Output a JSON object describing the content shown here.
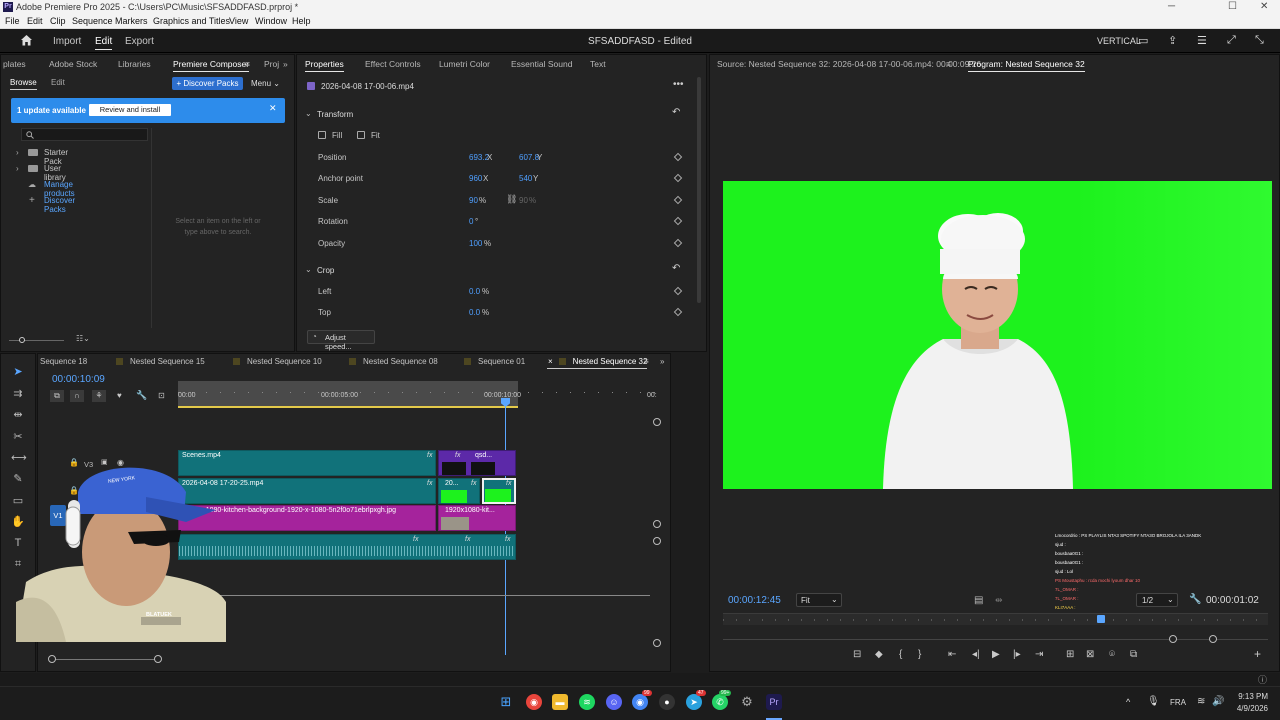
{
  "window": {
    "title": "Adobe Premiere Pro 2025 - C:\\Users\\PC\\Music\\SFSADDFASD.prproj *",
    "app_icon": "Pr"
  },
  "menu": [
    "File",
    "Edit",
    "Clip",
    "Sequence",
    "Markers",
    "Graphics and Titles",
    "View",
    "Window",
    "Help"
  ],
  "header": {
    "tabs": [
      "Import",
      "Edit",
      "Export"
    ],
    "active_tab": "Edit",
    "project_title": "SFSADDFASD - Edited",
    "layout_mode": "VERTICAL"
  },
  "left_panel": {
    "tabs": [
      "plates",
      "Adobe Stock",
      "Libraries",
      "Premiere Composer",
      "Proj"
    ],
    "active_tab": "Premiere Composer",
    "sub_tabs": [
      "Browse",
      "Edit"
    ],
    "discover_button": "+ Discover Packs",
    "menu_label": "Menu",
    "banner_text": "1 update available",
    "banner_button": "Review and install",
    "tree": [
      "Starter Pack",
      "User library",
      "Manage products",
      "Discover Packs"
    ],
    "empty_hint": "Select an item on the left or type above to search."
  },
  "properties": {
    "tabs": [
      "Properties",
      "Effect Controls",
      "Lumetri Color",
      "Essential Sound",
      "Text"
    ],
    "active_tab": "Properties",
    "clip_name": "2026-04-08 17-00-06.mp4",
    "transform": {
      "section_title": "Transform",
      "fill_label": "Fill",
      "fit_label": "Fit",
      "rows": [
        {
          "label": "Position",
          "v1": "693.2",
          "u1": "X",
          "v2": "607.8",
          "u2": "Y"
        },
        {
          "label": "Anchor point",
          "v1": "960",
          "u1": "X",
          "v2": "540",
          "u2": "Y"
        },
        {
          "label": "Scale",
          "v1": "90",
          "u1": "%",
          "v2": "90",
          "u2": "%"
        },
        {
          "label": "Rotation",
          "v1": "0",
          "u1": "°",
          "v2": "",
          "u2": ""
        },
        {
          "label": "Opacity",
          "v1": "100",
          "u1": "%",
          "v2": "",
          "u2": ""
        }
      ]
    },
    "crop": {
      "section_title": "Crop",
      "rows": [
        {
          "label": "Left",
          "v1": "0.0",
          "u1": "%"
        },
        {
          "label": "Top",
          "v1": "0.0",
          "u1": "%"
        }
      ]
    },
    "adjust_speed": "Adjust speed..."
  },
  "monitor": {
    "source_tab": "Source: Nested Sequence 32: 2026-04-08 17-00-06.mp4: 00:00:09:26",
    "program_tab": "Program: Nested Sequence 32",
    "current_time": "00:00:12:45",
    "fit": "Fit",
    "resolution": "1/2",
    "duration": "00:00:01:02",
    "chat_lines": [
      "Lmocordrio : PS PLAYLIS NTA3 SPOTIFY NTA3O BROJOLA ILA 3ANDK",
      "sjud :",
      "bousbaa0G1 :",
      "bousbaa0G1 :",
      "sjud : Lol",
      "PS Moustaphu : rcda mochi lyoum dhar 10",
      "7L_OMAR :",
      "7L_OMAR :",
      "KLI7AAA :"
    ]
  },
  "timeline": {
    "sequence_tabs": [
      "Sequence 18",
      "Nested Sequence 15",
      "Nested Sequence 10",
      "Nested Sequence 08",
      "Sequence 01",
      "Nested Sequence 32"
    ],
    "active_sequence": "Nested Sequence 32",
    "timecode": "00:00:10:09",
    "ruler": [
      "00:00",
      "00:00:05:00",
      "00:00:10:00",
      "00:"
    ],
    "tracks": [
      "V3",
      "V2",
      "V1"
    ],
    "clips": {
      "v3_main": "Scenes.mp4",
      "v3_short": "qsd...",
      "v2_main": "2026-04-08 17-20-25.mp4",
      "v2_short": "20...",
      "v1_main": "1920-x-1080-kitchen-background-1920-x-1080-5n2f0o71ebrlpxgh.jpg",
      "v1_short": "1920x1080-kit..."
    },
    "webcam_cap_text": "NEW YORK",
    "webcam_shirt_text": "BLATUEK"
  },
  "taskbar": {
    "language": "FRA",
    "time": "9:13 PM",
    "date": "4/9/2026",
    "badges": {
      "chrome_alt": "99",
      "telegram": "47",
      "whatsapp": "99+"
    }
  },
  "colors": {
    "accent_blue": "#2d8ceb",
    "timecode_blue": "#5aa6ff",
    "clip_teal": "#11727a",
    "clip_magenta": "#a5239c",
    "clip_purple": "#5c29a8",
    "green_screen": "#1df21d"
  }
}
